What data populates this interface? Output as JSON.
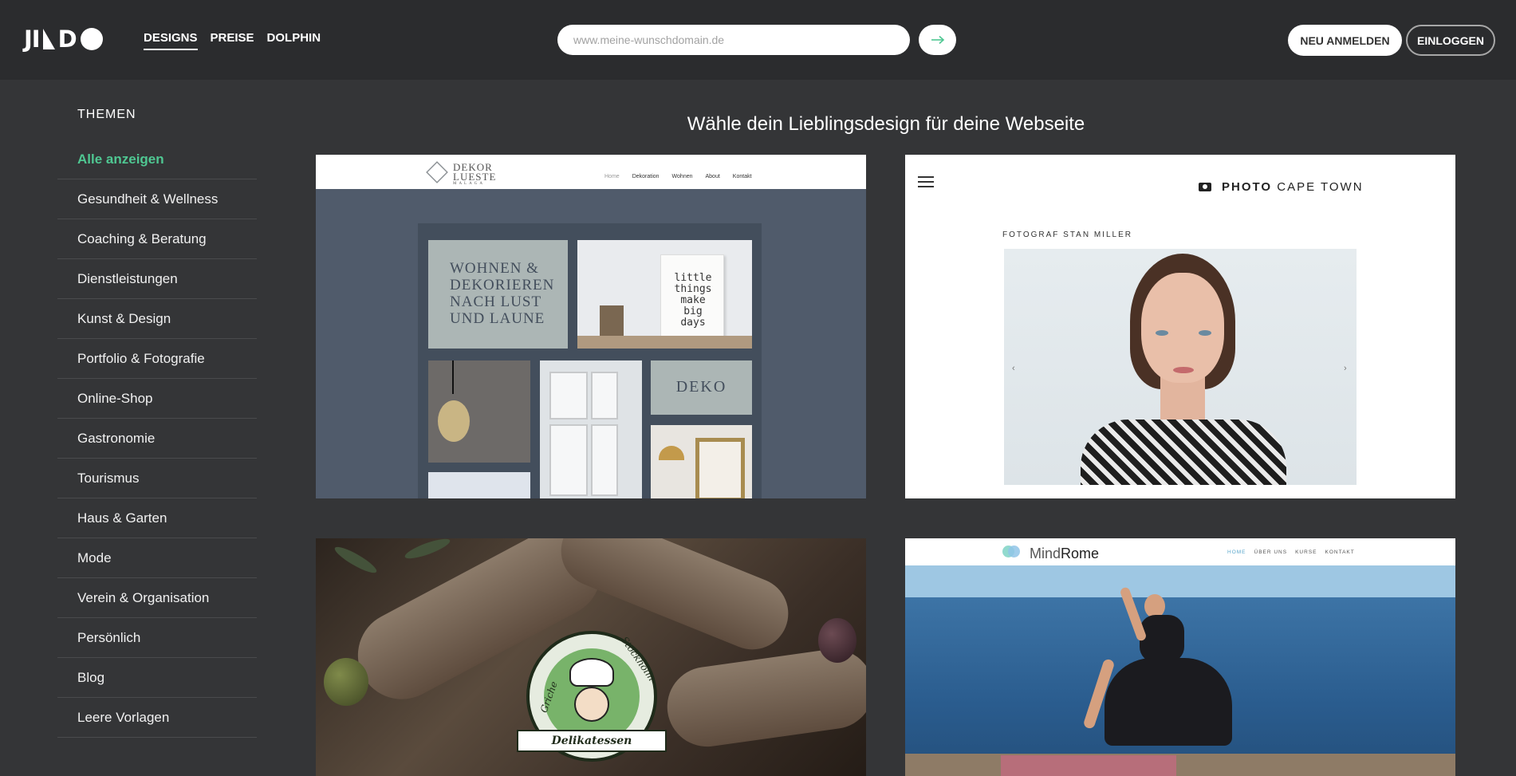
{
  "header": {
    "logo_text": "JIMDO",
    "nav": [
      {
        "label": "DESIGNS",
        "active": true
      },
      {
        "label": "PREISE",
        "active": false
      },
      {
        "label": "DOLPHIN",
        "active": false
      }
    ],
    "domain_placeholder": "www.meine-wunschdomain.de",
    "go_icon": "arrow-right-icon",
    "register_label": "NEU ANMELDEN",
    "login_label": "EINLOGGEN"
  },
  "sidebar": {
    "title": "THEMEN",
    "categories": [
      "Alle anzeigen",
      "Gesundheit & Wellness",
      "Coaching & Beratung",
      "Dienstleistungen",
      "Kunst & Design",
      "Portfolio & Fotografie",
      "Online-Shop",
      "Gastronomie",
      "Tourismus",
      "Haus & Garten",
      "Mode",
      "Verein & Organisation",
      "Persönlich",
      "Blog",
      "Leere Vorlagen"
    ],
    "active_category": "Alle anzeigen"
  },
  "main": {
    "headline": "Wähle dein Lieblingsdesign für deine Webseite",
    "designs": [
      {
        "brand_line1": "DEKOR",
        "brand_line2": "LUESTE",
        "brand_sub": "MALAGA",
        "nav": [
          "Home",
          "Dekoration",
          "Wohnen",
          "About",
          "Kontakt"
        ],
        "tile_text": "WOHNEN &\nDEKORIEREN\nNACH LUST\nUND LAUNE",
        "board_text": "little\nthings\nmake\nbig\ndays",
        "deko_text": "DEKO"
      },
      {
        "brand_bold": "PHOTO",
        "brand_light": "CAPE TOWN",
        "caption": "FOTOGRAF STAN MILLER",
        "prev_arrow": "‹",
        "next_arrow": "›"
      },
      {
        "badge_top_left": "Griche",
        "badge_top_right": "Stockholm",
        "badge_ribbon": "Delikatessen"
      },
      {
        "brand_light": "Mind",
        "brand_bold": "Rome",
        "nav": [
          "HOME",
          "ÜBER UNS",
          "KURSE",
          "KONTAKT"
        ]
      }
    ]
  },
  "colors": {
    "page_bg": "#343537",
    "header_bg": "#2b2c2e",
    "accent": "#4fc792",
    "go_arrow": "#4fc792"
  }
}
